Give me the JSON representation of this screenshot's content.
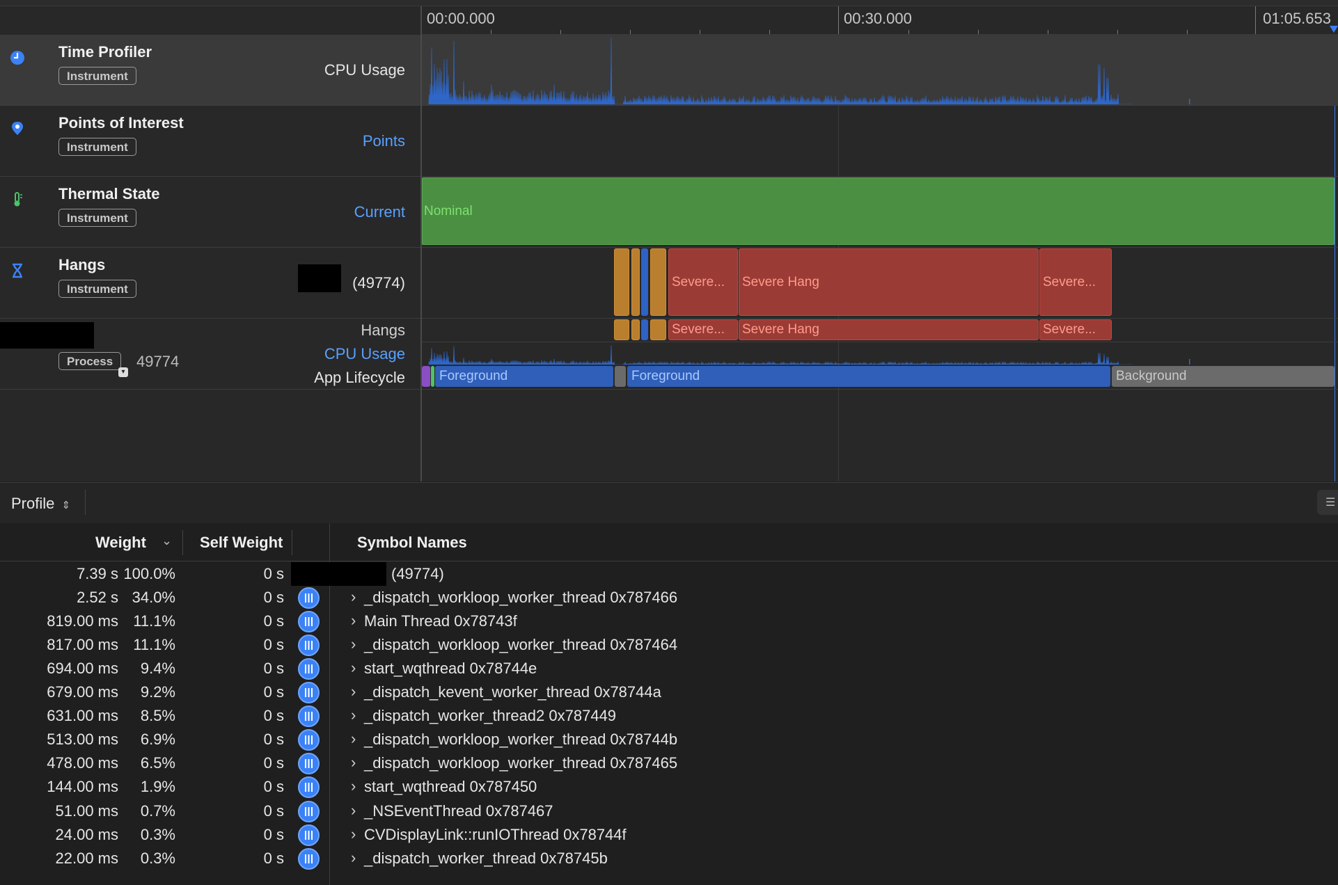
{
  "ruler": {
    "start": "00:00.000",
    "mid": "00:30.000",
    "end": "01:05.653"
  },
  "tracks": {
    "time_profiler": {
      "name": "Time Profiler",
      "badge": "Instrument",
      "lane": "CPU Usage"
    },
    "poi": {
      "name": "Points of Interest",
      "badge": "Instrument",
      "lane": "Points"
    },
    "thermal": {
      "name": "Thermal State",
      "badge": "Instrument",
      "lane": "Current",
      "state": "Nominal"
    },
    "hangs": {
      "name": "Hangs",
      "badge": "Instrument",
      "lane": "(49774)",
      "segments": [
        "Severe...",
        "Severe Hang",
        "Severe..."
      ]
    },
    "process": {
      "badge": "Process",
      "pid": "49774",
      "lanes": [
        "Hangs",
        "CPU Usage",
        "App Lifecycle"
      ],
      "lifecycle": [
        "Foreground",
        "Foreground",
        "Background"
      ]
    }
  },
  "colors": {
    "cpu": "#2f67c9",
    "nominal": "#4a8f42",
    "nominal_text": "#7ee06f",
    "hang_red": "#9b3b35",
    "hang_orange": "#b97f2e",
    "foreground": "#2f5fb8",
    "background": "#6b6b6b",
    "link_blue": "#5aa0ff"
  },
  "profile": {
    "selector": "Profile",
    "columns": {
      "weight": "Weight",
      "self_weight": "Self Weight",
      "symbol": "Symbol Names"
    },
    "rows": [
      {
        "weight": "7.39 s",
        "percent": "100.0%",
        "self": "0 s",
        "name": "(49774)",
        "root": true
      },
      {
        "weight": "2.52 s",
        "percent": "34.0%",
        "self": "0 s",
        "name": "_dispatch_workloop_worker_thread  0x787466"
      },
      {
        "weight": "819.00 ms",
        "percent": "11.1%",
        "self": "0 s",
        "name": "Main Thread  0x78743f"
      },
      {
        "weight": "817.00 ms",
        "percent": "11.1%",
        "self": "0 s",
        "name": "_dispatch_workloop_worker_thread  0x787464"
      },
      {
        "weight": "694.00 ms",
        "percent": "9.4%",
        "self": "0 s",
        "name": "start_wqthread  0x78744e"
      },
      {
        "weight": "679.00 ms",
        "percent": "9.2%",
        "self": "0 s",
        "name": "_dispatch_kevent_worker_thread  0x78744a"
      },
      {
        "weight": "631.00 ms",
        "percent": "8.5%",
        "self": "0 s",
        "name": "_dispatch_worker_thread2  0x787449"
      },
      {
        "weight": "513.00 ms",
        "percent": "6.9%",
        "self": "0 s",
        "name": "_dispatch_workloop_worker_thread  0x78744b"
      },
      {
        "weight": "478.00 ms",
        "percent": "6.5%",
        "self": "0 s",
        "name": "_dispatch_workloop_worker_thread  0x787465"
      },
      {
        "weight": "144.00 ms",
        "percent": "1.9%",
        "self": "0 s",
        "name": "start_wqthread  0x787450"
      },
      {
        "weight": "51.00 ms",
        "percent": "0.7%",
        "self": "0 s",
        "name": "_NSEventThread  0x787467"
      },
      {
        "weight": "24.00 ms",
        "percent": "0.3%",
        "self": "0 s",
        "name": "CVDisplayLink::runIOThread  0x78744f"
      },
      {
        "weight": "22.00 ms",
        "percent": "0.3%",
        "self": "0 s",
        "name": "_dispatch_worker_thread  0x78745b"
      }
    ]
  }
}
